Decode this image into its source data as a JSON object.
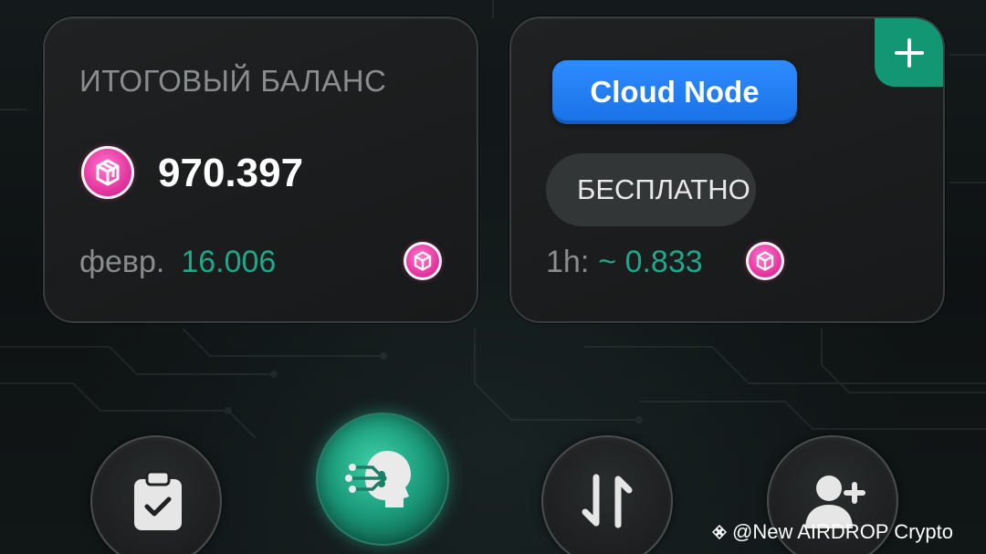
{
  "balance_card": {
    "title": "ИТОГОВЫЙ БАЛАНС",
    "value": "970.397",
    "month_label": "февр.",
    "month_value": "16.006",
    "coin_icon": "pink-token-icon"
  },
  "node_card": {
    "node_button_label": "Cloud Node",
    "price_label": "БЕСПЛАТНО",
    "rate_label": "1h:",
    "rate_value": "~ 0.833",
    "add_icon": "plus-icon"
  },
  "bottom_nav": {
    "items": [
      {
        "icon": "clipboard-check-icon"
      },
      {
        "icon": "ai-head-icon"
      },
      {
        "icon": "swap-arrows-icon"
      },
      {
        "icon": "add-user-icon"
      }
    ]
  },
  "watermark": {
    "text": "@New AIRDROP Crypto",
    "icon": "binance-icon"
  },
  "colors": {
    "accent_green": "#1ea88a",
    "plus_corner": "#129673",
    "node_button": "#1f7bf0",
    "coin_pink": "#e5369f"
  }
}
